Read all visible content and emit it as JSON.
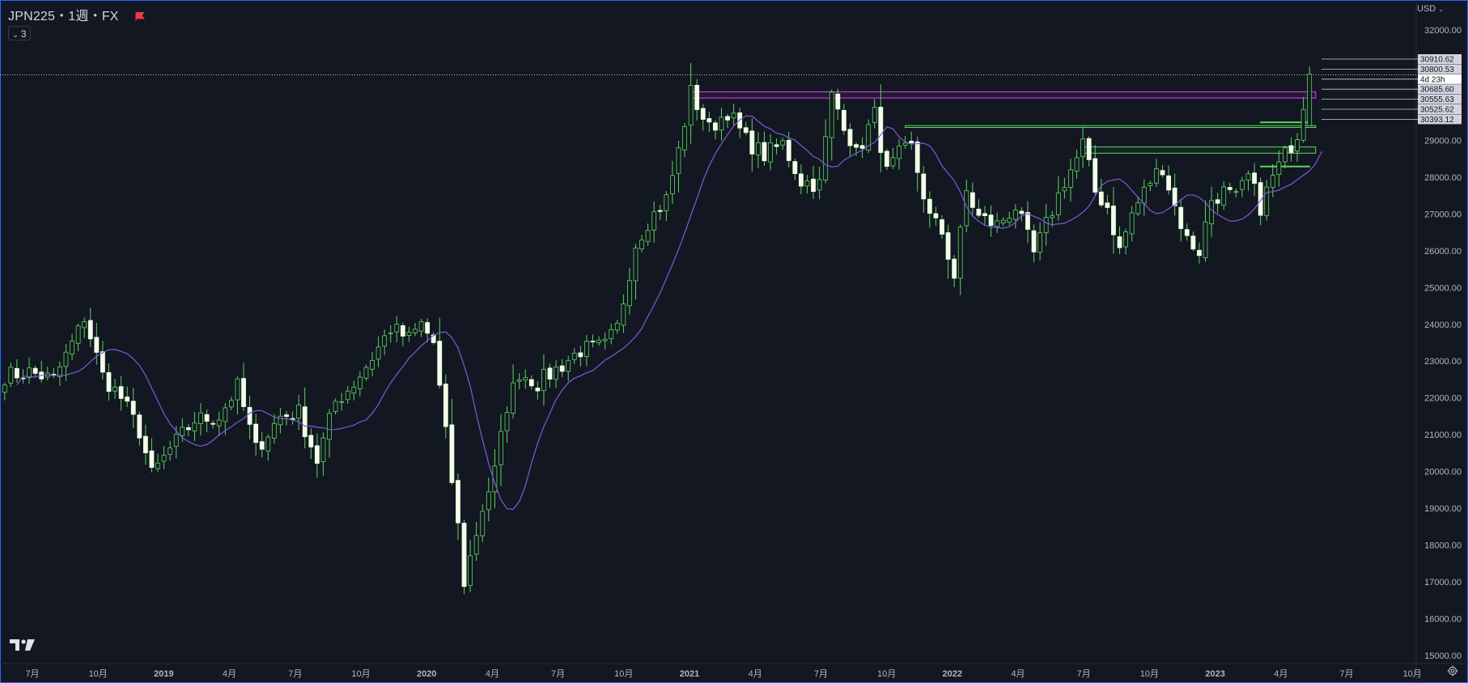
{
  "header": {
    "symbol": "JPN225・1週・FX",
    "indicator_count": "3",
    "currency": "USD"
  },
  "colors": {
    "background": "#131722",
    "candle_up_fill": "#131722",
    "candle_up_border": "#5cd65c",
    "candle_down_fill": "#f2ffe6",
    "wick": "#5cd65c",
    "ma_line": "#7b5cd6",
    "resistance_zone": "#e040fb",
    "support_lines": "#5cd65c",
    "axis_text": "#b2b5be",
    "price_tag_bg": "#d1d4dc",
    "price_tag_text": "#131722"
  },
  "chart_data": {
    "type": "candlestick",
    "interval": "1W",
    "symbol": "JPN225",
    "y_ticks": [
      "15000.00",
      "16000.00",
      "17000.00",
      "18000.00",
      "19000.00",
      "20000.00",
      "21000.00",
      "22000.00",
      "23000.00",
      "24000.00",
      "25000.00",
      "26000.00",
      "27000.00",
      "28000.00",
      "29000.00",
      "32000.00"
    ],
    "x_ticks": [
      "7月",
      "10月",
      "2019",
      "4月",
      "7月",
      "10月",
      "2020",
      "4月",
      "7月",
      "10月",
      "2021",
      "4月",
      "7月",
      "10月",
      "2022",
      "4月",
      "7月",
      "10月",
      "2023",
      "4月",
      "7月",
      "10月"
    ],
    "ylim": [
      14850,
      32350
    ],
    "anchors": [
      {
        "t": 0,
        "v": 22600
      },
      {
        "t": 4,
        "v": 22700
      },
      {
        "t": 8,
        "v": 22500
      },
      {
        "t": 12,
        "v": 23800
      },
      {
        "t": 13,
        "v": 24200
      },
      {
        "t": 16,
        "v": 22600
      },
      {
        "t": 19,
        "v": 22000
      },
      {
        "t": 22,
        "v": 21100
      },
      {
        "t": 24,
        "v": 19900
      },
      {
        "t": 27,
        "v": 20600
      },
      {
        "t": 31,
        "v": 21400
      },
      {
        "t": 35,
        "v": 21500
      },
      {
        "t": 38,
        "v": 22300
      },
      {
        "t": 41,
        "v": 20600
      },
      {
        "t": 45,
        "v": 21500
      },
      {
        "t": 48,
        "v": 21600
      },
      {
        "t": 51,
        "v": 20300
      },
      {
        "t": 54,
        "v": 21900
      },
      {
        "t": 57,
        "v": 22400
      },
      {
        "t": 60,
        "v": 23100
      },
      {
        "t": 63,
        "v": 23900
      },
      {
        "t": 66,
        "v": 23600
      },
      {
        "t": 68,
        "v": 24000
      },
      {
        "t": 70,
        "v": 23500
      },
      {
        "t": 72,
        "v": 21000
      },
      {
        "t": 74,
        "v": 18500
      },
      {
        "t": 75,
        "v": 17000
      },
      {
        "t": 78,
        "v": 19000
      },
      {
        "t": 80,
        "v": 20000
      },
      {
        "t": 82,
        "v": 21800
      },
      {
        "t": 84,
        "v": 22700
      },
      {
        "t": 87,
        "v": 22400
      },
      {
        "t": 91,
        "v": 22900
      },
      {
        "t": 94,
        "v": 23300
      },
      {
        "t": 98,
        "v": 23400
      },
      {
        "t": 100,
        "v": 23900
      },
      {
        "t": 103,
        "v": 26200
      },
      {
        "t": 105,
        "v": 26800
      },
      {
        "t": 108,
        "v": 27400
      },
      {
        "t": 110,
        "v": 28700
      },
      {
        "t": 112,
        "v": 30300
      },
      {
        "t": 115,
        "v": 29300
      },
      {
        "t": 118,
        "v": 29800
      },
      {
        "t": 121,
        "v": 29000
      },
      {
        "t": 124,
        "v": 28600
      },
      {
        "t": 127,
        "v": 28900
      },
      {
        "t": 130,
        "v": 27900
      },
      {
        "t": 133,
        "v": 27800
      },
      {
        "t": 135,
        "v": 30200
      },
      {
        "t": 137,
        "v": 29500
      },
      {
        "t": 139,
        "v": 28600
      },
      {
        "t": 142,
        "v": 29700
      },
      {
        "t": 144,
        "v": 28100
      },
      {
        "t": 146,
        "v": 28600
      },
      {
        "t": 148,
        "v": 28800
      },
      {
        "t": 151,
        "v": 26900
      },
      {
        "t": 153,
        "v": 26500
      },
      {
        "t": 155,
        "v": 25300
      },
      {
        "t": 157,
        "v": 27600
      },
      {
        "t": 159,
        "v": 26900
      },
      {
        "t": 162,
        "v": 26700
      },
      {
        "t": 165,
        "v": 27200
      },
      {
        "t": 168,
        "v": 25900
      },
      {
        "t": 170,
        "v": 26700
      },
      {
        "t": 173,
        "v": 27900
      },
      {
        "t": 175,
        "v": 28500
      },
      {
        "t": 176,
        "v": 28900
      },
      {
        "t": 178,
        "v": 27600
      },
      {
        "t": 180,
        "v": 27200
      },
      {
        "t": 182,
        "v": 26000
      },
      {
        "t": 184,
        "v": 27000
      },
      {
        "t": 187,
        "v": 27900
      },
      {
        "t": 189,
        "v": 28300
      },
      {
        "t": 191,
        "v": 27200
      },
      {
        "t": 193,
        "v": 26300
      },
      {
        "t": 195,
        "v": 26000
      },
      {
        "t": 197,
        "v": 27400
      },
      {
        "t": 199,
        "v": 27600
      },
      {
        "t": 201,
        "v": 27400
      },
      {
        "t": 203,
        "v": 28000
      },
      {
        "t": 205,
        "v": 27200
      },
      {
        "t": 207,
        "v": 28000
      },
      {
        "t": 209,
        "v": 28600
      },
      {
        "t": 211,
        "v": 29200
      },
      {
        "t": 213,
        "v": 30900
      }
    ],
    "ma_period": 9,
    "resistance_zone": {
      "from_week": 112,
      "to_week": 214,
      "low": 30150,
      "high": 30320
    },
    "support_lines": [
      {
        "from_week": 147,
        "to_week": 214,
        "low": 29350,
        "high": 29400
      },
      {
        "from_week": 176,
        "to_week": 214,
        "low": 28650,
        "high": 28820
      },
      {
        "from_week": 205,
        "to_week": 213,
        "low": 28300,
        "high": 28300
      },
      {
        "from_week": 205,
        "to_week": 213,
        "low": 29500,
        "high": 29500
      }
    ],
    "current_price": 30910.62,
    "price_tags": [
      {
        "text": "30910.62",
        "value": 30910.62,
        "kind": "current"
      },
      {
        "text": "30800.53",
        "value": 30800.53,
        "kind": "level"
      },
      {
        "text": "4d 23h",
        "value": 30670,
        "kind": "countdown"
      },
      {
        "text": "30685.60",
        "value": 30685.6,
        "kind": "level"
      },
      {
        "text": "30555.63",
        "value": 30555.63,
        "kind": "level"
      },
      {
        "text": "30525.62",
        "value": 30525.62,
        "kind": "level"
      },
      {
        "text": "30393.12",
        "value": 30393.12,
        "kind": "level"
      }
    ]
  }
}
